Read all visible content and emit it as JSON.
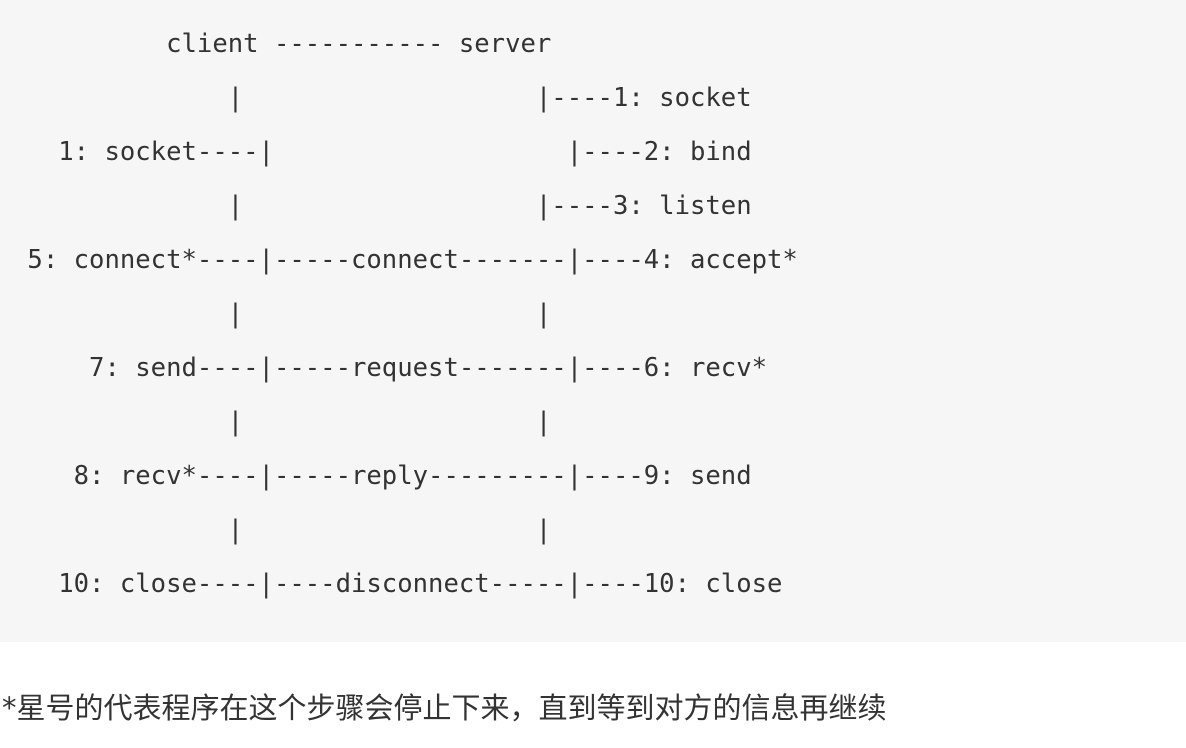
{
  "code_block": {
    "lines": [
      "          client ----------- server",
      "              |                   |----1: socket",
      "   1: socket----|                   |----2: bind",
      "              |                   |----3: listen",
      " 5: connect*----|-----connect-------|----4: accept*",
      "              |                   |",
      "     7: send----|-----request-------|----6: recv*",
      "              |                   |",
      "    8: recv*----|-----reply---------|----9: send",
      "              |                   |",
      "   10: close----|----disconnect-----|----10: close"
    ]
  },
  "note": {
    "text": "*星号的代表程序在这个步骤会停止下来，直到等到对方的信息再继续"
  }
}
